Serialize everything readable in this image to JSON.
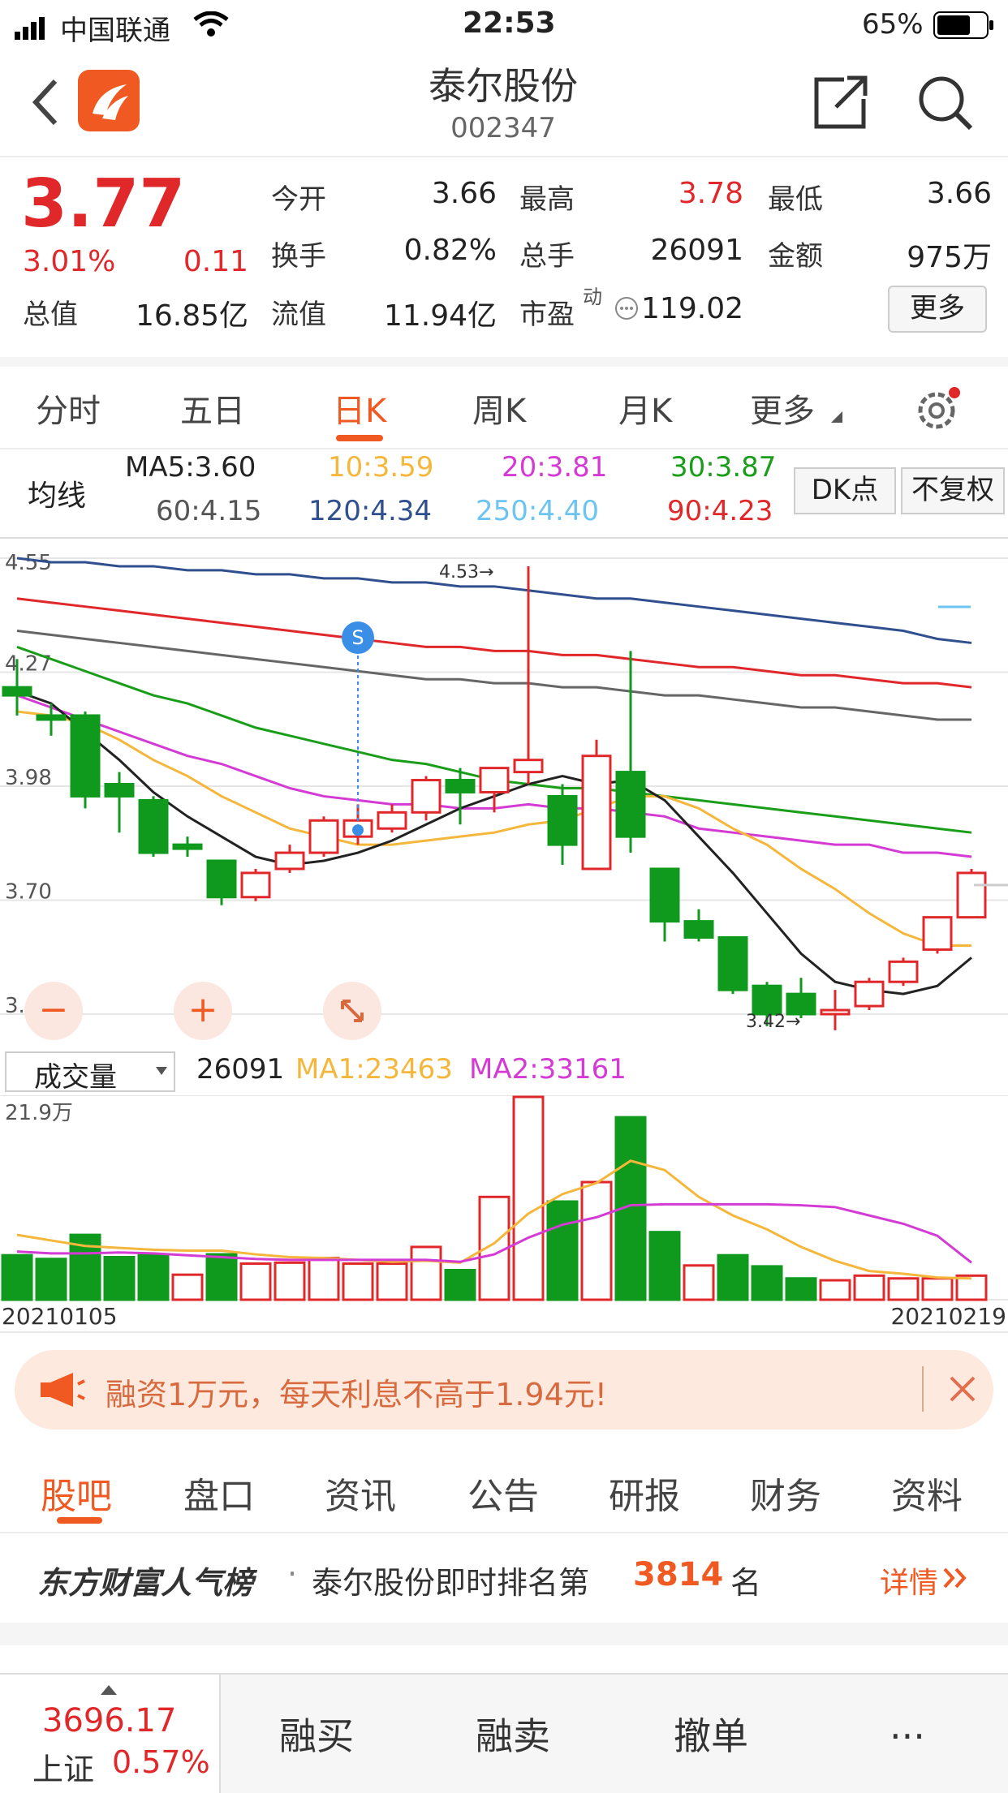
{
  "status": {
    "carrier": "中国联通",
    "time": "22:53",
    "battery": "65%"
  },
  "header": {
    "name": "泰尔股份",
    "code": "002347"
  },
  "quote": {
    "price": "3.77",
    "pct": "3.01%",
    "chg": "0.11",
    "open_lbl": "今开",
    "open": "3.66",
    "high_lbl": "最高",
    "high": "3.78",
    "low_lbl": "最低",
    "low": "3.66",
    "turnover_lbl": "换手",
    "turnover": "0.82%",
    "vol_lbl": "总手",
    "vol": "26091",
    "amount_lbl": "金额",
    "amount": "975万",
    "mcap_lbl": "总值",
    "mcap": "16.85亿",
    "float_lbl": "流值",
    "float": "11.94亿",
    "pe_lbl": "市盈",
    "pe_sup": "动",
    "pe": "119.02",
    "more": "更多"
  },
  "tabs": [
    "分时",
    "五日",
    "日K",
    "周K",
    "月K",
    "更多"
  ],
  "ma": {
    "label": "均线",
    "ma5": "MA5:3.60",
    "ma10": "10:3.59",
    "ma20": "20:3.81",
    "ma30": "30:3.87",
    "ma60": "60:4.15",
    "ma120": "120:4.34",
    "ma250": "250:4.40",
    "ma90": "90:4.23",
    "dk": "DK点",
    "fq": "不复权"
  },
  "colors": {
    "up": "#e0282b",
    "down": "#0f9a1d",
    "ma5": "#222222",
    "ma10": "#f5b73b",
    "ma20": "#d43bd4",
    "ma30": "#1a9e1a",
    "ma60": "#666666",
    "ma120": "#2f4f8f",
    "ma250": "#6cc4f0",
    "ma90": "#e0282b"
  },
  "chart_data": {
    "type": "candlestick",
    "ylim": [
      3.42,
      4.55
    ],
    "yticks": [
      "4.55",
      "4.27",
      "3.98",
      "3.70",
      "3.42"
    ],
    "annotations": {
      "high": "4.53",
      "low": "3.42",
      "signal": "S"
    },
    "x_start": "20210105",
    "x_end": "20210219",
    "candles": [
      {
        "o": 4.23,
        "c": 4.21,
        "h": 4.3,
        "l": 4.16
      },
      {
        "o": 4.16,
        "c": 4.15,
        "h": 4.19,
        "l": 4.11
      },
      {
        "o": 4.16,
        "c": 3.96,
        "h": 4.17,
        "l": 3.93
      },
      {
        "o": 3.99,
        "c": 3.96,
        "h": 4.02,
        "l": 3.87
      },
      {
        "o": 3.95,
        "c": 3.82,
        "h": 3.96,
        "l": 3.81
      },
      {
        "o": 3.84,
        "c": 3.83,
        "h": 3.86,
        "l": 3.81
      },
      {
        "o": 3.8,
        "c": 3.71,
        "h": 3.8,
        "l": 3.69
      },
      {
        "o": 3.71,
        "c": 3.77,
        "h": 3.78,
        "l": 3.7
      },
      {
        "o": 3.78,
        "c": 3.82,
        "h": 3.84,
        "l": 3.77
      },
      {
        "o": 3.82,
        "c": 3.9,
        "h": 3.91,
        "l": 3.81
      },
      {
        "o": 3.86,
        "c": 3.9,
        "h": 3.94,
        "l": 3.84
      },
      {
        "o": 3.88,
        "c": 3.92,
        "h": 3.94,
        "l": 3.87
      },
      {
        "o": 3.92,
        "c": 4.0,
        "h": 4.01,
        "l": 3.9
      },
      {
        "o": 4.0,
        "c": 3.97,
        "h": 4.03,
        "l": 3.89
      },
      {
        "o": 3.97,
        "c": 4.03,
        "h": 4.03,
        "l": 3.92
      },
      {
        "o": 4.02,
        "c": 4.05,
        "h": 4.53,
        "l": 3.99
      },
      {
        "o": 3.96,
        "c": 3.84,
        "h": 3.99,
        "l": 3.79
      },
      {
        "o": 3.78,
        "c": 4.06,
        "h": 4.1,
        "l": 3.78
      },
      {
        "o": 4.02,
        "c": 3.86,
        "h": 4.32,
        "l": 3.82
      },
      {
        "o": 3.78,
        "c": 3.65,
        "h": 3.78,
        "l": 3.6
      },
      {
        "o": 3.65,
        "c": 3.61,
        "h": 3.68,
        "l": 3.6
      },
      {
        "o": 3.61,
        "c": 3.48,
        "h": 3.61,
        "l": 3.47
      },
      {
        "o": 3.49,
        "c": 3.42,
        "h": 3.5,
        "l": 3.39
      },
      {
        "o": 3.47,
        "c": 3.42,
        "h": 3.51,
        "l": 3.41
      },
      {
        "o": 3.42,
        "c": 3.43,
        "h": 3.48,
        "l": 3.38
      },
      {
        "o": 3.44,
        "c": 3.5,
        "h": 3.51,
        "l": 3.43
      },
      {
        "o": 3.5,
        "c": 3.55,
        "h": 3.56,
        "l": 3.49
      },
      {
        "o": 3.58,
        "c": 3.66,
        "h": 3.66,
        "l": 3.57
      },
      {
        "o": 3.66,
        "c": 3.77,
        "h": 3.78,
        "l": 3.66
      }
    ],
    "ma_lines": {
      "ma5": [
        4.22,
        4.19,
        4.12,
        4.05,
        3.97,
        3.91,
        3.86,
        3.81,
        3.79,
        3.8,
        3.82,
        3.85,
        3.89,
        3.93,
        3.96,
        3.99,
        4.01,
        3.99,
        4.0,
        3.95,
        3.86,
        3.77,
        3.67,
        3.57,
        3.5,
        3.48,
        3.47,
        3.49,
        3.56
      ],
      "ma10": [
        4.17,
        4.16,
        4.14,
        4.1,
        4.05,
        4.01,
        3.96,
        3.92,
        3.88,
        3.86,
        3.84,
        3.84,
        3.85,
        3.86,
        3.87,
        3.89,
        3.9,
        3.93,
        3.96,
        3.96,
        3.93,
        3.88,
        3.84,
        3.78,
        3.73,
        3.67,
        3.62,
        3.59,
        3.59
      ],
      "ma20": [
        4.21,
        4.18,
        4.15,
        4.12,
        4.09,
        4.06,
        4.04,
        4.01,
        3.98,
        3.96,
        3.95,
        3.94,
        3.94,
        3.93,
        3.93,
        3.94,
        3.93,
        3.93,
        3.92,
        3.91,
        3.88,
        3.87,
        3.86,
        3.85,
        3.84,
        3.84,
        3.82,
        3.82,
        3.81
      ],
      "ma30": [
        4.33,
        4.3,
        4.27,
        4.24,
        4.21,
        4.19,
        4.16,
        4.13,
        4.11,
        4.09,
        4.07,
        4.05,
        4.04,
        4.02,
        4.0,
        3.99,
        3.98,
        3.98,
        3.97,
        3.96,
        3.95,
        3.94,
        3.93,
        3.92,
        3.91,
        3.9,
        3.89,
        3.88,
        3.87
      ],
      "ma60": [
        4.37,
        4.36,
        4.35,
        4.34,
        4.33,
        4.32,
        4.31,
        4.3,
        4.29,
        4.28,
        4.27,
        4.26,
        4.25,
        4.25,
        4.24,
        4.24,
        4.23,
        4.23,
        4.22,
        4.21,
        4.21,
        4.2,
        4.19,
        4.18,
        4.18,
        4.17,
        4.16,
        4.15,
        4.15
      ],
      "ma90": [
        4.45,
        4.44,
        4.43,
        4.42,
        4.41,
        4.4,
        4.39,
        4.38,
        4.37,
        4.36,
        4.35,
        4.34,
        4.33,
        4.33,
        4.32,
        4.32,
        4.31,
        4.31,
        4.3,
        4.29,
        4.28,
        4.28,
        4.27,
        4.26,
        4.26,
        4.25,
        4.24,
        4.24,
        4.23
      ],
      "ma120": [
        4.55,
        4.54,
        4.54,
        4.53,
        4.53,
        4.52,
        4.52,
        4.51,
        4.51,
        4.5,
        4.5,
        4.49,
        4.49,
        4.48,
        4.48,
        4.47,
        4.46,
        4.45,
        4.45,
        4.44,
        4.43,
        4.42,
        4.41,
        4.4,
        4.39,
        4.38,
        4.37,
        4.35,
        4.34
      ]
    },
    "volume": {
      "label": "成交量",
      "value": "26091",
      "ma1": "MA1:23463",
      "ma2": "MA2:33161",
      "ymax_label": "21.9万",
      "bars": [
        {
          "v": 4.8,
          "up": false
        },
        {
          "v": 4.4,
          "up": false
        },
        {
          "v": 7.0,
          "up": false
        },
        {
          "v": 4.6,
          "up": false
        },
        {
          "v": 4.8,
          "up": false
        },
        {
          "v": 2.7,
          "up": true
        },
        {
          "v": 4.9,
          "up": false
        },
        {
          "v": 3.9,
          "up": true
        },
        {
          "v": 4.0,
          "up": true
        },
        {
          "v": 4.5,
          "up": true
        },
        {
          "v": 3.9,
          "up": true
        },
        {
          "v": 3.9,
          "up": true
        },
        {
          "v": 5.7,
          "up": true
        },
        {
          "v": 3.2,
          "up": false
        },
        {
          "v": 11.1,
          "up": true
        },
        {
          "v": 21.9,
          "up": true
        },
        {
          "v": 10.6,
          "up": false
        },
        {
          "v": 12.7,
          "up": true
        },
        {
          "v": 19.7,
          "up": false
        },
        {
          "v": 7.3,
          "up": false
        },
        {
          "v": 3.7,
          "up": true
        },
        {
          "v": 4.8,
          "up": false
        },
        {
          "v": 3.6,
          "up": false
        },
        {
          "v": 2.3,
          "up": false
        },
        {
          "v": 2.1,
          "up": true
        },
        {
          "v": 2.6,
          "up": true
        },
        {
          "v": 2.3,
          "up": true
        },
        {
          "v": 2.3,
          "up": true
        },
        {
          "v": 2.6,
          "up": true
        }
      ],
      "ma1_line": [
        7.0,
        6.4,
        5.8,
        5.6,
        5.4,
        5.3,
        5.3,
        4.9,
        4.6,
        4.5,
        4.3,
        4.1,
        4.2,
        4.0,
        6.1,
        9.3,
        11.4,
        12.6,
        15.0,
        14.0,
        11.1,
        9.1,
        7.6,
        5.7,
        4.2,
        3.1,
        2.8,
        2.4,
        2.3
      ],
      "ma2_line": [
        5.2,
        5.0,
        5.0,
        5.1,
        5.0,
        4.8,
        4.6,
        4.4,
        4.3,
        4.3,
        4.3,
        4.3,
        4.3,
        4.1,
        4.9,
        6.7,
        8.1,
        8.9,
        10.2,
        10.3,
        10.3,
        10.3,
        10.3,
        10.2,
        10.0,
        9.1,
        8.2,
        6.9,
        4.0
      ]
    }
  },
  "zoom": {
    "minus": "−",
    "plus": "+"
  },
  "banner": {
    "text": "融资1万元，每天利息不高于1.94元!"
  },
  "news_tabs": [
    "股吧",
    "盘口",
    "资讯",
    "公告",
    "研报",
    "财务",
    "资料"
  ],
  "rank": {
    "brand": "东方财富人气榜",
    "text": "泰尔股份即时排名第",
    "num": "3814",
    "unit": "名",
    "detail": "详情"
  },
  "index": {
    "value": "3696.17",
    "name": "上证",
    "pct": "0.57%"
  },
  "bottom": {
    "buy": "融买",
    "sell": "融卖",
    "cancel": "撤单",
    "more": "..."
  }
}
